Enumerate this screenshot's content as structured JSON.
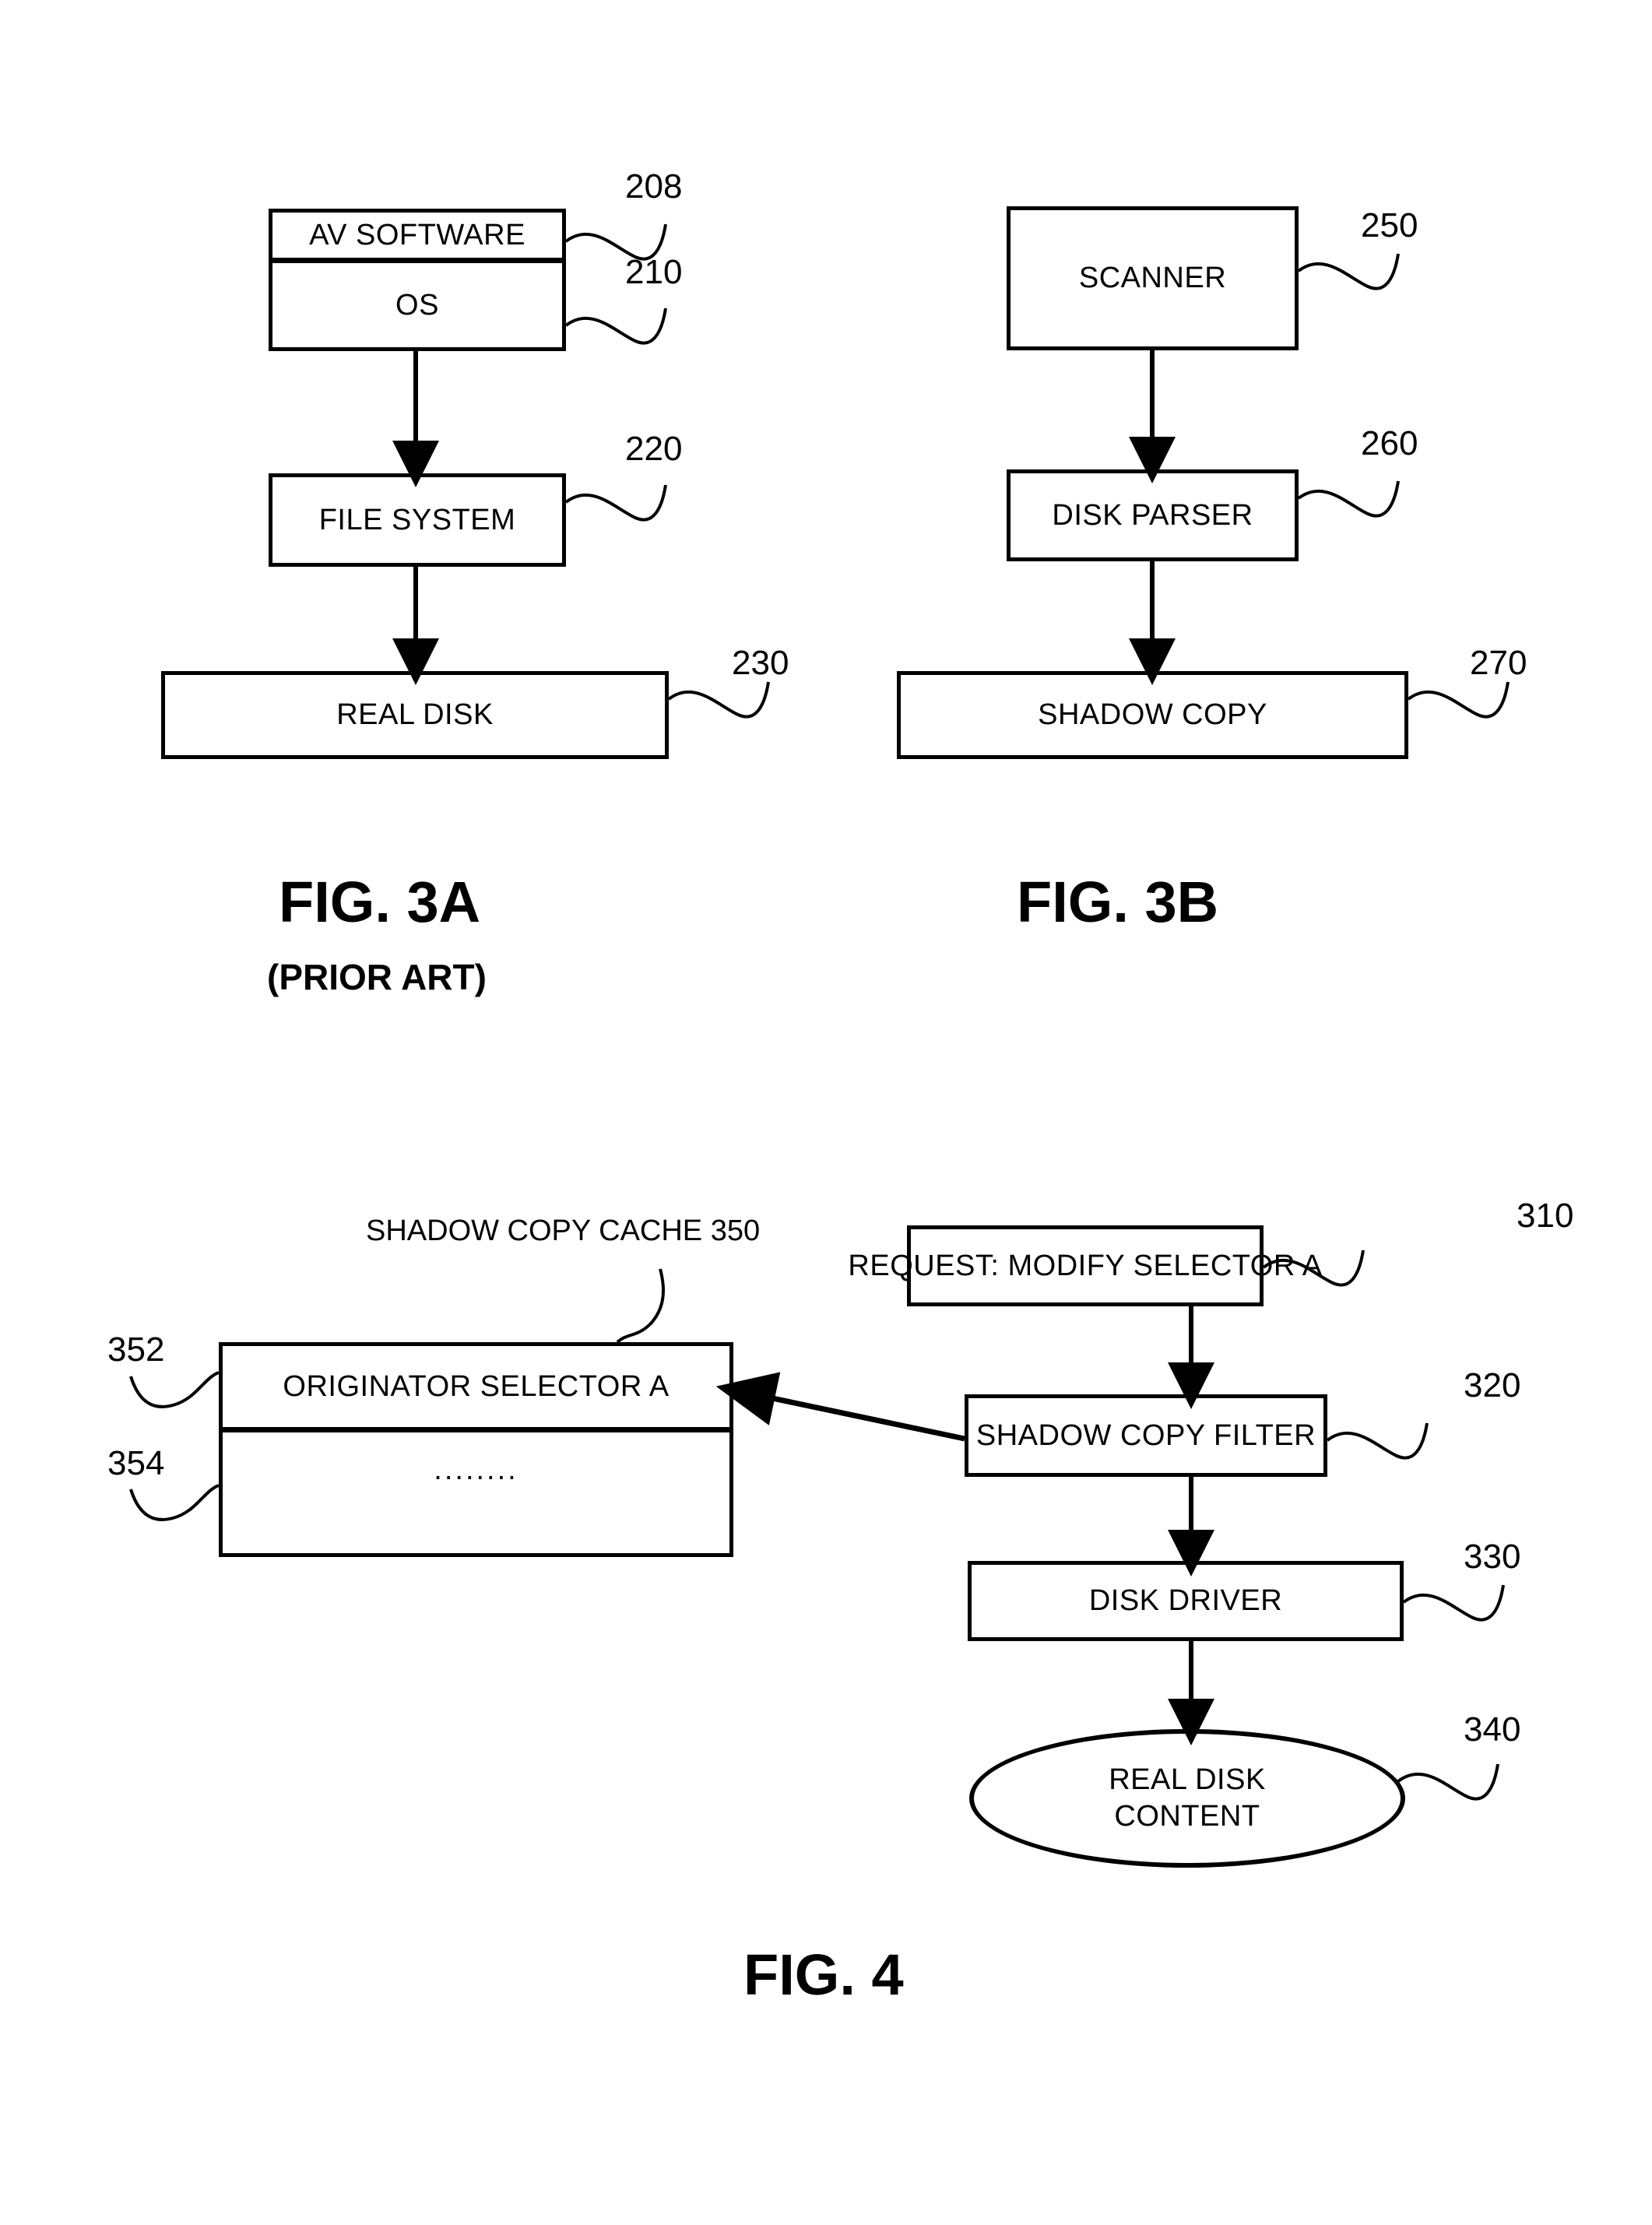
{
  "figures": [
    {
      "id": "fig-3a",
      "caption": "FIG. 3A",
      "subcaption": "(PRIOR ART)",
      "nodes": [
        {
          "label": "AV SOFTWARE",
          "ref": "208"
        },
        {
          "label": "OS",
          "ref": "210"
        },
        {
          "label": "FILE SYSTEM",
          "ref": "220"
        },
        {
          "label": "REAL DISK",
          "ref": "230"
        }
      ]
    },
    {
      "id": "fig-3b",
      "caption": "FIG. 3B",
      "subcaption": "",
      "nodes": [
        {
          "label": "SCANNER",
          "ref": "250"
        },
        {
          "label": "DISK PARSER",
          "ref": "260"
        },
        {
          "label": "SHADOW COPY",
          "ref": "270"
        }
      ]
    },
    {
      "id": "fig-4",
      "caption": "FIG. 4",
      "subcaption": "",
      "nodes": [
        {
          "label": "REQUEST: MODIFY SELECTOR A",
          "ref": "310"
        },
        {
          "label": "SHADOW COPY FILTER",
          "ref": "320"
        },
        {
          "label": "DISK DRIVER",
          "ref": "330"
        },
        {
          "label": "REAL DISK CONTENT",
          "ref": "340"
        },
        {
          "label": "ORIGINATOR SELECTOR A",
          "ref": "352"
        },
        {
          "label": "........",
          "ref": "354"
        }
      ],
      "cache_title": "SHADOW COPY CACHE 350"
    }
  ],
  "fig3a": {
    "av_software": "AV SOFTWARE",
    "os": "OS",
    "file_system": "FILE SYSTEM",
    "real_disk": "REAL DISK",
    "ref_208": "208",
    "ref_210": "210",
    "ref_220": "220",
    "ref_230": "230",
    "caption": "FIG. 3A",
    "subcaption": "(PRIOR ART)"
  },
  "fig3b": {
    "scanner": "SCANNER",
    "disk_parser": "DISK PARSER",
    "shadow_copy": "SHADOW COPY",
    "ref_250": "250",
    "ref_260": "260",
    "ref_270": "270",
    "caption": "FIG. 3B"
  },
  "fig4": {
    "cache_title": "SHADOW COPY CACHE 350",
    "originator_selector": "ORIGINATOR SELECTOR A",
    "cache_rows_ellipsis": "........",
    "request": "REQUEST: MODIFY SELECTOR A",
    "shadow_copy_filter": "SHADOW COPY FILTER",
    "disk_driver": "DISK DRIVER",
    "real_disk_content_line1": "REAL DISK",
    "real_disk_content_line2": "CONTENT",
    "ref_310": "310",
    "ref_320": "320",
    "ref_330": "330",
    "ref_340": "340",
    "ref_352": "352",
    "ref_354": "354",
    "caption": "FIG. 4"
  },
  "colors": {
    "line": "#000000",
    "background": "#ffffff"
  }
}
